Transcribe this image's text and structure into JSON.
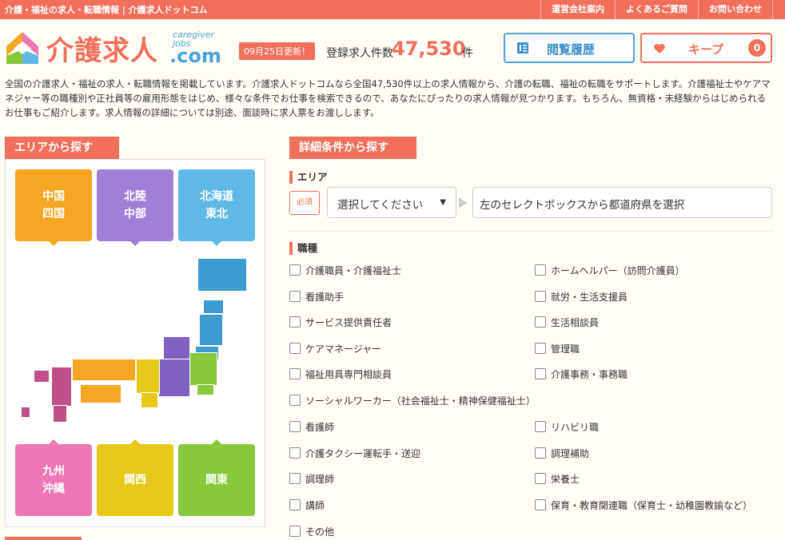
{
  "topbar": {
    "tagline": "介護・福祉の求人・転職情報 | 介護求人ドットコム",
    "links": [
      "運営会社案内",
      "よくあるご質問",
      "お問い合わせ"
    ]
  },
  "header": {
    "logo_jp": "介護求人",
    "logo_en_line1": "caregiver",
    "logo_en_line2": "jobs",
    "logo_com": ".com",
    "updated_badge": "09月25日更新！",
    "count_label": "登録求人件数",
    "count_value": "47,530",
    "count_unit": "件",
    "history_button": "閲覧履歴",
    "keep_button": "キープ",
    "keep_count": "0"
  },
  "intro": "全国の介護求人・福祉の求人・転職情報を掲載しています。介護求人ドットコムなら全国47,530件以上の求人情報から、介護の転職、福祉の転職をサポートします。介護福祉士やケアマネジャー等の職種別や正社員等の雇用形態をはじめ、様々な条件でお仕事を検索できるので、あなたにぴったりの求人情報が見つかります。もちろん、無資格・未経験からはじめられるお仕事もご紹介します。求人情報の詳細については別途、面談時に求人票をお渡しします。",
  "area_search": {
    "heading": "エリアから探す",
    "regions": [
      {
        "label": "中国\n四国",
        "color": "#f5a623"
      },
      {
        "label": "北陸\n中部",
        "color": "#a07fd8"
      },
      {
        "label": "北海道\n東北",
        "color": "#5fb8e8"
      },
      {
        "label": "九州\n沖縄",
        "color": "#f077b5"
      },
      {
        "label": "関西",
        "color": "#e8c81a"
      },
      {
        "label": "関東",
        "color": "#88c83a"
      }
    ]
  },
  "detail_search": {
    "heading": "詳細条件から探す",
    "area_label": "エリア",
    "required_badge": "必須",
    "select_value": "選択してください",
    "pref_hint": "左のセレクトボックスから都道府県を選択",
    "job_label": "職種",
    "jobs": [
      "介護職員・介護福祉士",
      "ホームヘルパー（訪問介護員）",
      "看護助手",
      "就労・生活支援員",
      "サービス提供責任者",
      "生活相談員",
      "ケアマネージャー",
      "管理職",
      "福祉用具専門相談員",
      "介護事務・事務職",
      "ソーシャルワーカー（社会福祉士・精神保健福祉士）",
      "看護師",
      "リハビリ職",
      "介護タクシー運転手・送迎",
      "調理補助",
      "調理師",
      "栄養士",
      "講師",
      "保育・教育関連職（保育士・幼稚園教諭など）",
      "その他"
    ]
  },
  "colors": {
    "accent": "#f0705a",
    "blue": "#4aa3d8"
  }
}
